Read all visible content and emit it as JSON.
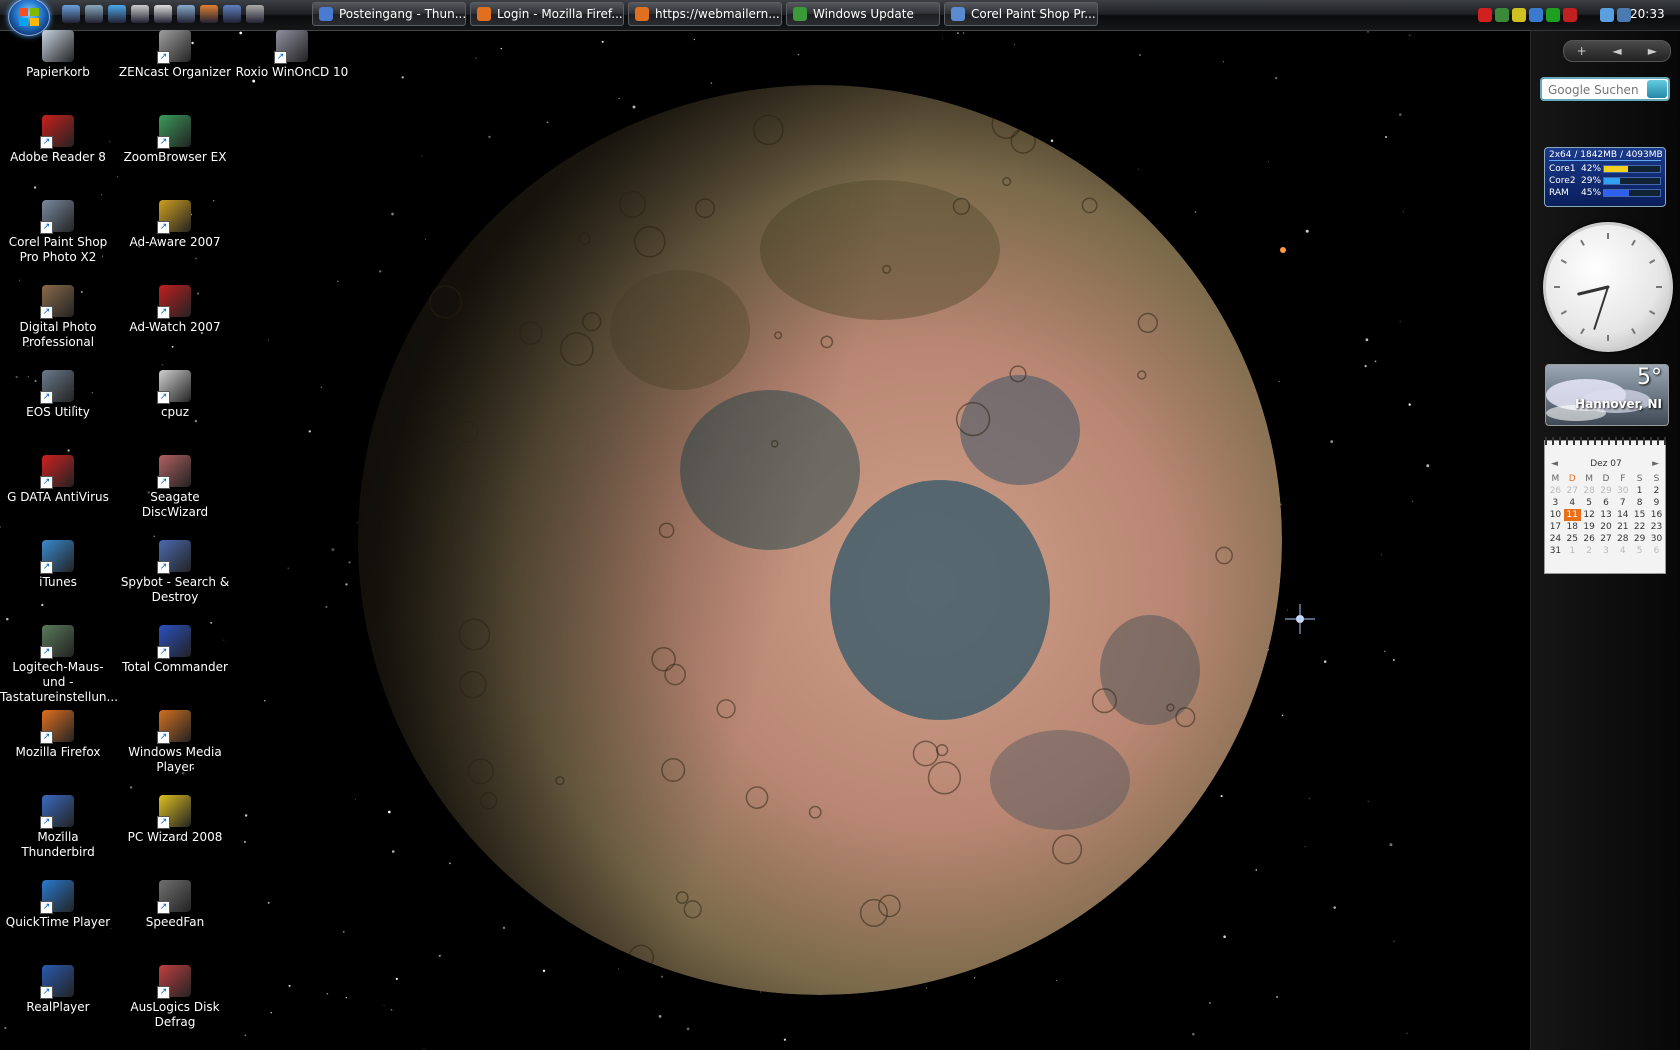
{
  "taskbar": {
    "quick_launch": [
      "show-desktop-icon",
      "switch-windows-icon",
      "internet-explorer-icon",
      "mouse-icon",
      "save-icon",
      "globe-icon",
      "firefox-icon",
      "thunderbird-icon",
      "screenshot-icon"
    ],
    "tasks": [
      {
        "label": "Posteingang - Thun...",
        "icon": "thunderbird-icon",
        "color": "#4a7bd0"
      },
      {
        "label": "Login - Mozilla Firef...",
        "icon": "firefox-icon",
        "color": "#e07020"
      },
      {
        "label": "https://webmailern...",
        "icon": "firefox-icon",
        "color": "#e07020"
      },
      {
        "label": "Windows Update",
        "icon": "windows-update-icon",
        "color": "#3a9a3a"
      },
      {
        "label": "Corel Paint Shop Pr...",
        "icon": "paint-shop-icon",
        "color": "#5a8ad0"
      }
    ],
    "tray_icons": [
      "close-red-icon",
      "network-icon",
      "arrow-icon",
      "green-icon",
      "shield-icon",
      "shield-red-icon",
      "speaker-icon",
      "monitor-icon"
    ],
    "clock": "20:33"
  },
  "desktop": {
    "icons": [
      {
        "label": "Papierkorb",
        "icon": "recycle-bin-icon",
        "color": "#c8d4e0"
      },
      {
        "label": "Adobe Reader 8",
        "icon": "adobe-reader-icon",
        "color": "#c8201c"
      },
      {
        "label": "Corel Paint Shop Pro Photo X2",
        "icon": "corel-psp-icon",
        "color": "#7a8aa0"
      },
      {
        "label": "Digital Photo Professional",
        "icon": "digital-photo-icon",
        "color": "#8a6a4a"
      },
      {
        "label": "EOS Utility",
        "icon": "eos-utility-icon",
        "color": "#6a7a8a"
      },
      {
        "label": "G DATA AntiVirus",
        "icon": "gdata-icon",
        "color": "#d02020"
      },
      {
        "label": "iTunes",
        "icon": "itunes-icon",
        "color": "#3a8ad0"
      },
      {
        "label": "Logitech-Maus- und -Tastatureinstellun...",
        "icon": "logitech-icon",
        "color": "#5a7a5a"
      },
      {
        "label": "Mozilla Firefox",
        "icon": "firefox-icon",
        "color": "#e07020"
      },
      {
        "label": "Mozilla Thunderbird",
        "icon": "thunderbird-icon",
        "color": "#3a6ac0"
      },
      {
        "label": "QuickTime Player",
        "icon": "quicktime-icon",
        "color": "#2a7ad0"
      },
      {
        "label": "RealPlayer",
        "icon": "realplayer-icon",
        "color": "#2a5ab0"
      },
      {
        "label": "ZENcast Organizer",
        "icon": "zencast-icon",
        "color": "#a0a0a0"
      },
      {
        "label": "ZoomBrowser EX",
        "icon": "zoombrowser-icon",
        "color": "#3a9a5a"
      },
      {
        "label": "Ad-Aware 2007",
        "icon": "ad-aware-icon",
        "color": "#d0a020"
      },
      {
        "label": "Ad-Watch 2007",
        "icon": "ad-watch-icon",
        "color": "#c02020"
      },
      {
        "label": "cpuz",
        "icon": "cpuz-icon",
        "color": "#d0d0d0"
      },
      {
        "label": "Seagate DiscWizard",
        "icon": "seagate-icon",
        "color": "#b06060"
      },
      {
        "label": "Spybot - Search & Destroy",
        "icon": "spybot-icon",
        "color": "#4a6ab0"
      },
      {
        "label": "Total Commander",
        "icon": "total-commander-icon",
        "color": "#2a50c0"
      },
      {
        "label": "Windows Media Player",
        "icon": "media-player-icon",
        "color": "#d07020"
      },
      {
        "label": "PC Wizard 2008",
        "icon": "pc-wizard-icon",
        "color": "#e0c020"
      },
      {
        "label": "SpeedFan",
        "icon": "speedfan-icon",
        "color": "#707070"
      },
      {
        "label": "AusLogics Disk Defrag",
        "icon": "defrag-icon",
        "color": "#c04040"
      },
      {
        "label": "Roxio WinOnCD 10",
        "icon": "roxio-icon",
        "color": "#9090a0"
      }
    ]
  },
  "sidebar": {
    "controls": {
      "add": "+",
      "prev": "◄",
      "next": "►"
    },
    "search_placeholder": "Google Suchen",
    "cpu_meter": {
      "header": "2x64 / 1842MB / 4093MB",
      "rows": [
        {
          "name": "Core1",
          "value": "42%",
          "level": 0.42,
          "color": "#f0d020"
        },
        {
          "name": "Core2",
          "value": "29%",
          "level": 0.29,
          "color": "#30a0f0"
        },
        {
          "name": "RAM",
          "value": "45%",
          "level": 0.45,
          "color": "#3060f0"
        }
      ]
    },
    "clock_time": {
      "hour": 8,
      "minute": 33
    },
    "weather": {
      "temp": "5°",
      "city": "Hannover, NI"
    },
    "calendar": {
      "month": "Dez 07",
      "weekdays": [
        "M",
        "D",
        "M",
        "D",
        "F",
        "S",
        "S"
      ],
      "current_weekday_index": 1,
      "weeks": [
        [
          "26",
          "27",
          "28",
          "29",
          "30",
          "1",
          "2"
        ],
        [
          "3",
          "4",
          "5",
          "6",
          "7",
          "8",
          "9"
        ],
        [
          "10",
          "11",
          "12",
          "13",
          "14",
          "15",
          "16"
        ],
        [
          "17",
          "18",
          "19",
          "20",
          "21",
          "22",
          "23"
        ],
        [
          "24",
          "25",
          "26",
          "27",
          "28",
          "29",
          "30"
        ],
        [
          "31",
          "1",
          "2",
          "3",
          "4",
          "5",
          "6"
        ]
      ],
      "muted_first_row_count": 5,
      "muted_last_row_from": 1,
      "today": "11"
    }
  }
}
